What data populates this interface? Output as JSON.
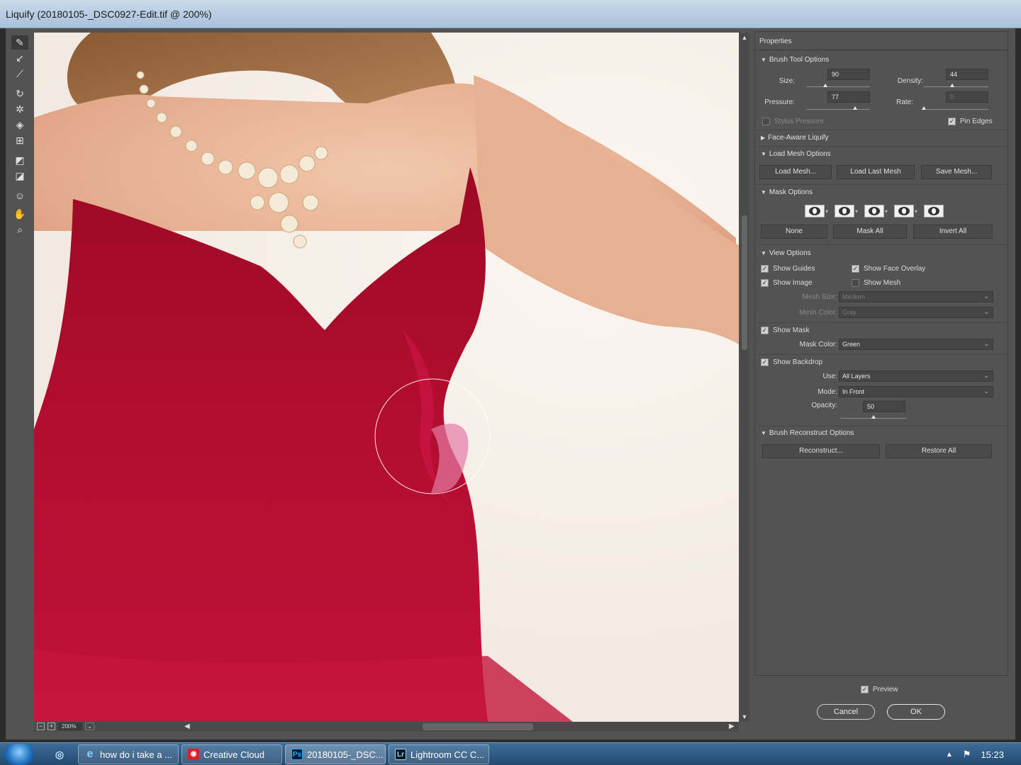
{
  "window": {
    "title": "Liquify (20180105-_DSC0927-Edit.tif @ 200%)"
  },
  "tools": [
    "forward-warp-icon",
    "reconstruct-icon",
    "smooth-icon",
    "twirl-icon",
    "pucker-icon",
    "bloat-icon",
    "push-left-icon",
    "freeze-mask-icon",
    "thaw-mask-icon",
    "face-tool-icon",
    "hand-icon",
    "zoom-icon"
  ],
  "canvas": {
    "zoom": "200%"
  },
  "properties": {
    "header": "Properties",
    "brush_tool_options": {
      "title": "Brush Tool Options",
      "size_label": "Size:",
      "size": "90",
      "size_level": 0.3,
      "density_label": "Density:",
      "density": "44",
      "density_level": 0.44,
      "pressure_label": "Pressure:",
      "pressure": "77",
      "pressure_level": 0.77,
      "rate_label": "Rate:",
      "rate": "0",
      "rate_level": 0.0,
      "stylus_pressure": "Stylus Pressure",
      "pin_edges": "Pin Edges"
    },
    "face_aware": {
      "title": "Face-Aware Liquify"
    },
    "load_mesh": {
      "title": "Load Mesh Options",
      "load_mesh": "Load Mesh...",
      "load_last_mesh": "Load Last Mesh",
      "save_mesh": "Save Mesh..."
    },
    "mask_options": {
      "title": "Mask Options",
      "none": "None",
      "mask_all": "Mask All",
      "invert_all": "Invert All"
    },
    "view_options": {
      "title": "View Options",
      "show_guides": "Show Guides",
      "show_face_overlay": "Show Face Overlay",
      "show_image": "Show Image",
      "show_mesh": "Show Mesh",
      "mesh_size_label": "Mesh Size:",
      "mesh_size": "Medium",
      "mesh_color_label": "Mesh Color:",
      "mesh_color": "Gray",
      "show_mask": "Show Mask",
      "mask_color_label": "Mask Color:",
      "mask_color": "Green",
      "show_backdrop": "Show Backdrop",
      "use_label": "Use:",
      "use": "All Layers",
      "mode_label": "Mode:",
      "mode": "In Front",
      "opacity_label": "Opacity:",
      "opacity": "50",
      "opacity_level": 0.5
    },
    "reconstruct": {
      "title": "Brush Reconstruct Options",
      "reconstruct": "Reconstruct...",
      "restore_all": "Restore All"
    }
  },
  "footer": {
    "preview": "Preview",
    "cancel": "Cancel",
    "ok": "OK"
  },
  "taskbar": {
    "items": [
      {
        "label": "how do i take a ..."
      },
      {
        "label": "Creative Cloud"
      },
      {
        "label": "20180105-_DSC..."
      },
      {
        "label": "Lightroom CC C..."
      }
    ],
    "clock": "15:23"
  },
  "colors": {
    "dress": "#a80a2a",
    "panel": "#535353",
    "accent": "#1e6fbf"
  }
}
